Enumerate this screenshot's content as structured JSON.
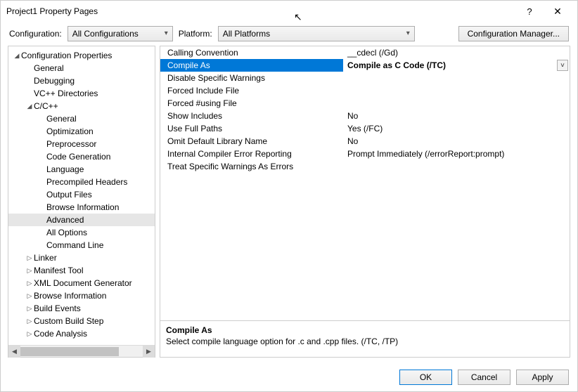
{
  "window": {
    "title": "Project1 Property Pages",
    "help": "?",
    "close": "✕"
  },
  "configRow": {
    "configLabel": "Configuration:",
    "configValue": "All Configurations",
    "platformLabel": "Platform:",
    "platformValue": "All Platforms",
    "managerBtn": "Configuration Manager..."
  },
  "tree": [
    {
      "level": 0,
      "arrow": "expanded",
      "label": "Configuration Properties"
    },
    {
      "level": 1,
      "arrow": "none",
      "label": "General"
    },
    {
      "level": 1,
      "arrow": "none",
      "label": "Debugging"
    },
    {
      "level": 1,
      "arrow": "none",
      "label": "VC++ Directories"
    },
    {
      "level": 1,
      "arrow": "expanded",
      "label": "C/C++"
    },
    {
      "level": 2,
      "arrow": "none",
      "label": "General"
    },
    {
      "level": 2,
      "arrow": "none",
      "label": "Optimization"
    },
    {
      "level": 2,
      "arrow": "none",
      "label": "Preprocessor"
    },
    {
      "level": 2,
      "arrow": "none",
      "label": "Code Generation"
    },
    {
      "level": 2,
      "arrow": "none",
      "label": "Language"
    },
    {
      "level": 2,
      "arrow": "none",
      "label": "Precompiled Headers"
    },
    {
      "level": 2,
      "arrow": "none",
      "label": "Output Files"
    },
    {
      "level": 2,
      "arrow": "none",
      "label": "Browse Information"
    },
    {
      "level": 2,
      "arrow": "none",
      "label": "Advanced",
      "selected": true
    },
    {
      "level": 2,
      "arrow": "none",
      "label": "All Options"
    },
    {
      "level": 2,
      "arrow": "none",
      "label": "Command Line"
    },
    {
      "level": 1,
      "arrow": "collapsed",
      "label": "Linker"
    },
    {
      "level": 1,
      "arrow": "collapsed",
      "label": "Manifest Tool"
    },
    {
      "level": 1,
      "arrow": "collapsed",
      "label": "XML Document Generator"
    },
    {
      "level": 1,
      "arrow": "collapsed",
      "label": "Browse Information"
    },
    {
      "level": 1,
      "arrow": "collapsed",
      "label": "Build Events"
    },
    {
      "level": 1,
      "arrow": "collapsed",
      "label": "Custom Build Step"
    },
    {
      "level": 1,
      "arrow": "collapsed",
      "label": "Code Analysis"
    }
  ],
  "props": [
    {
      "name": "Calling Convention",
      "value": "__cdecl (/Gd)"
    },
    {
      "name": "Compile As",
      "value": "Compile as C Code (/TC)",
      "selected": true,
      "dropdown": true
    },
    {
      "name": "Disable Specific Warnings",
      "value": ""
    },
    {
      "name": "Forced Include File",
      "value": ""
    },
    {
      "name": "Forced #using File",
      "value": ""
    },
    {
      "name": "Show Includes",
      "value": "No"
    },
    {
      "name": "Use Full Paths",
      "value": "Yes (/FC)"
    },
    {
      "name": "Omit Default Library Name",
      "value": "No"
    },
    {
      "name": "Internal Compiler Error Reporting",
      "value": "Prompt Immediately (/errorReport:prompt)"
    },
    {
      "name": "Treat Specific Warnings As Errors",
      "value": ""
    }
  ],
  "desc": {
    "title": "Compile As",
    "body": "Select compile language option for .c and .cpp files.     (/TC, /TP)"
  },
  "buttons": {
    "ok": "OK",
    "cancel": "Cancel",
    "apply": "Apply"
  },
  "scroll": {
    "left": "◀",
    "right": "▶"
  }
}
